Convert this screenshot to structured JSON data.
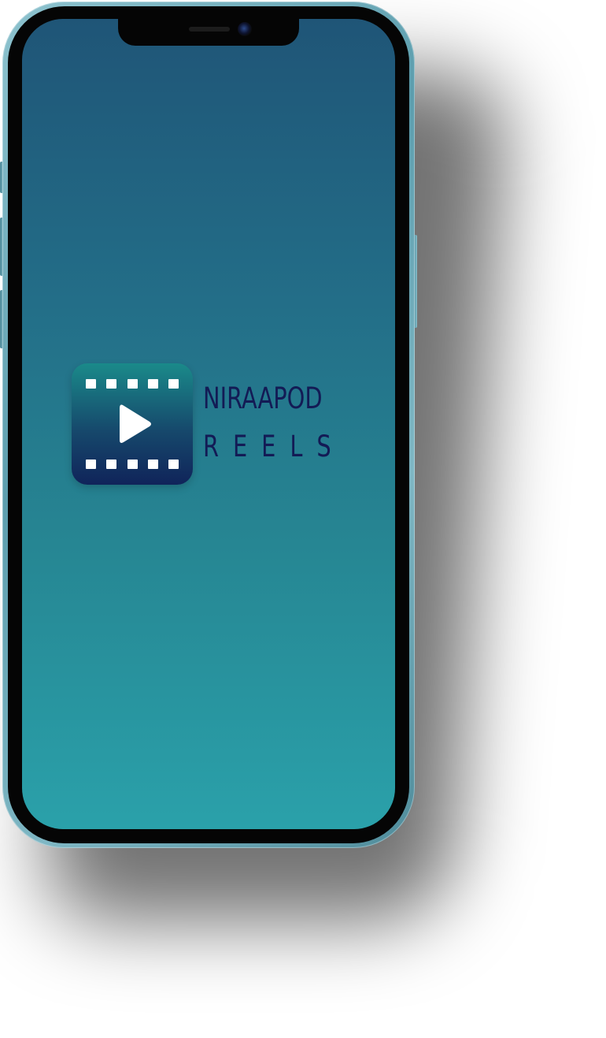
{
  "app": {
    "brand_line1": "NIRAAPOD",
    "brand_line2": "REELS",
    "logo_icon": "film-strip-play-icon"
  },
  "colors": {
    "screen_gradient_top": "#1f5577",
    "screen_gradient_bottom": "#2aa1aa",
    "brand_text": "#131b55",
    "icon_gradient_top": "#1a8a8a",
    "icon_gradient_bottom": "#10245a",
    "phone_frame": "#6fb0bf"
  }
}
